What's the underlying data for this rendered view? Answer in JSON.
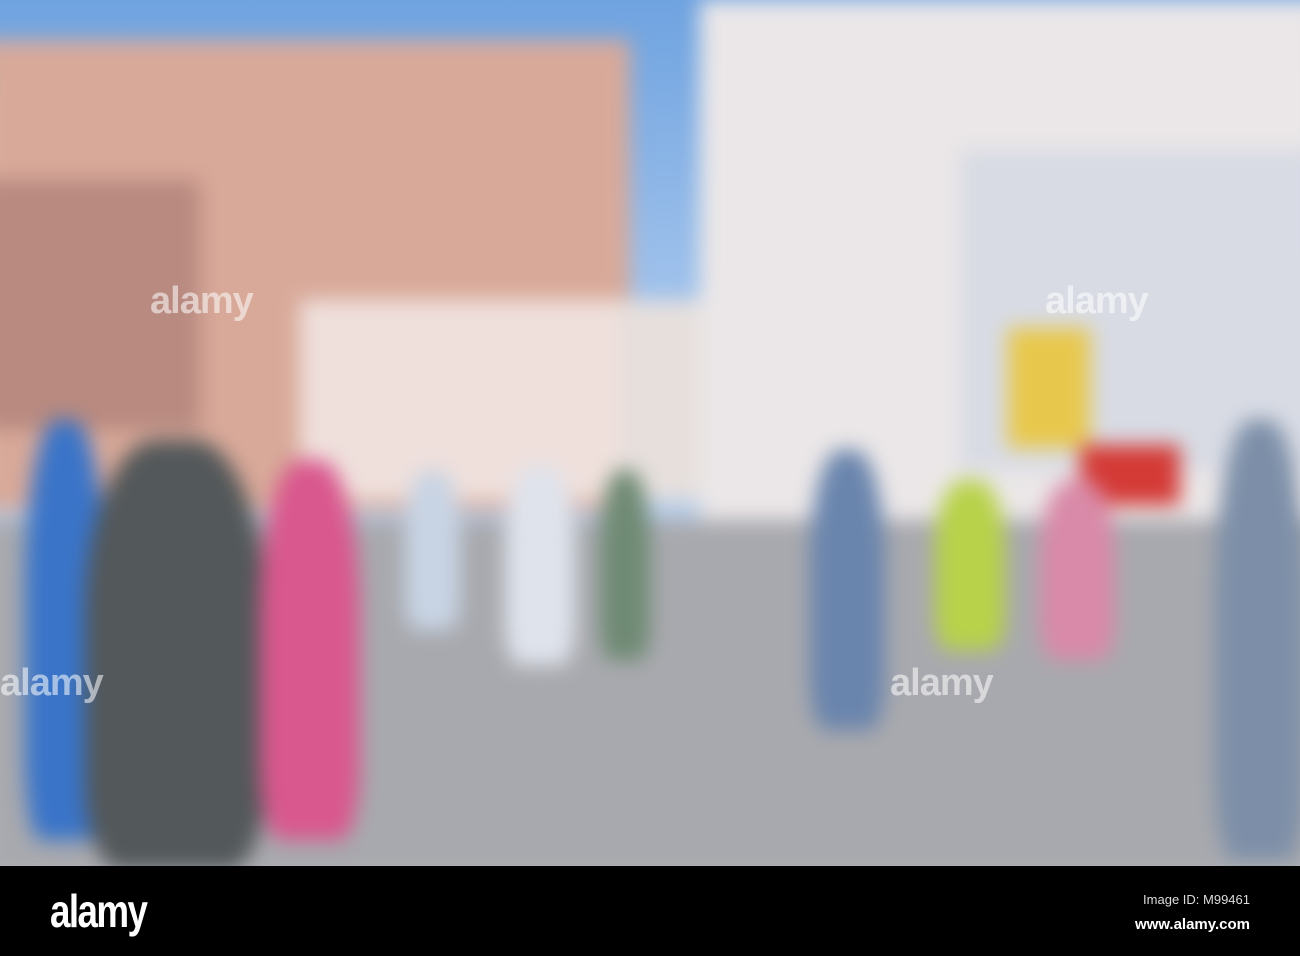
{
  "watermark": {
    "text": "alamy"
  },
  "footer": {
    "logo": "alamy",
    "image_id": "Image ID: M99461",
    "site": "www.alamy.com"
  },
  "colors": {
    "sky": "#7aaae3",
    "left_building": "#d6a898",
    "right_building": "#e9e6e6",
    "ground": "#a8a9ae",
    "footer": "#000000"
  }
}
